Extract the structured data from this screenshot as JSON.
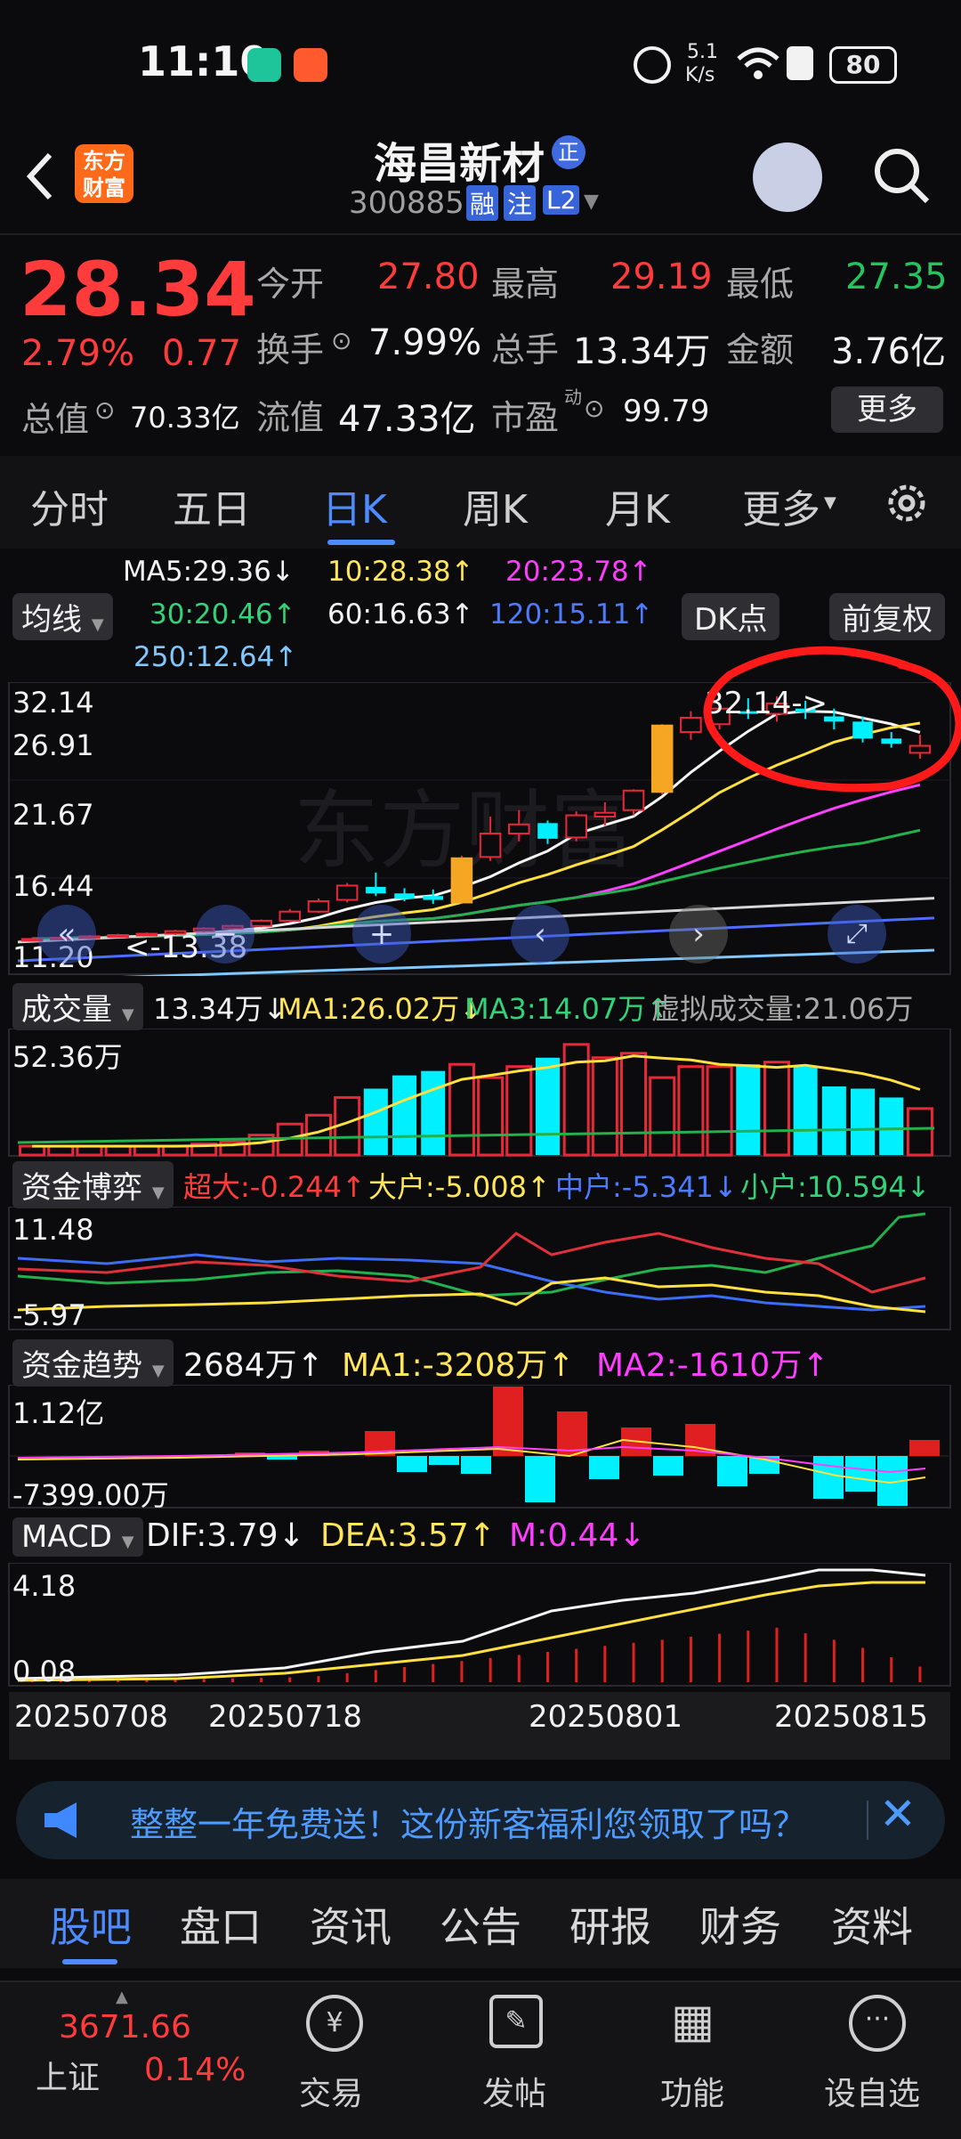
{
  "status_bar": {
    "time": "11:10",
    "net_speed_top": "5.1",
    "net_speed_unit": "K/s",
    "battery": "80"
  },
  "header": {
    "back_label": "<",
    "logo_line1": "东方",
    "logo_line2": "财富",
    "stock_name": "海昌新材",
    "badge_zheng": "正",
    "stock_code": "300885",
    "tag_rong": "融",
    "tag_zhu": "注",
    "tag_l2": "L2"
  },
  "quote": {
    "price": "28.34",
    "change_pct": "2.79%",
    "change_abs": "0.77",
    "open_label": "今开",
    "open": "27.80",
    "high_label": "最高",
    "high": "29.19",
    "low_label": "最低",
    "low": "27.35",
    "turnover_label": "换手",
    "turnover": "7.99%",
    "volume_label": "总手",
    "volume": "13.34万",
    "amount_label": "金额",
    "amount": "3.76亿",
    "total_mv_label": "总值",
    "total_mv": "70.33亿",
    "float_mv_label": "流值",
    "float_mv": "47.33亿",
    "pe_label": "市盈",
    "pe_sup": "动",
    "pe": "99.79",
    "more_label": "更多"
  },
  "period_tabs": [
    "分时",
    "五日",
    "日K",
    "周K",
    "月K",
    "更多"
  ],
  "active_tab": "日K",
  "ma_legend": {
    "ma5": "MA5:29.36↓",
    "ma10": "10:28.38↑",
    "ma20": "20:23.78↑",
    "ma30": "30:20.46↑",
    "ma60": "60:16.63↑",
    "ma120": "120:15.11↑",
    "ma250": "250:12.64↑",
    "junxian": "均线",
    "dk": "DK点",
    "fuquan": "前复权"
  },
  "kline": {
    "y_labels": [
      "32.14",
      "26.91",
      "21.67",
      "16.44",
      "11.20"
    ],
    "max_note": "32.14->",
    "min_note": "<-13.38"
  },
  "volume_panel": {
    "title": "成交量",
    "vol": "13.34万↓",
    "ma1": "MA1:26.02万↓",
    "ma3": "MA3:14.07万↑",
    "virtual": "虚拟成交量:21.06万",
    "y_label": "52.36万"
  },
  "fund_game": {
    "title": "资金博弈",
    "super": "超大:-0.244↑",
    "big": "大户:-5.008↑",
    "mid": "中户:-5.341↓",
    "small": "小户:10.594↓",
    "y_top": "11.48",
    "y_bottom": "-5.97"
  },
  "fund_trend": {
    "title": "资金趋势",
    "val": "2684万↑",
    "ma1": "MA1:-3208万↑",
    "ma2": "MA2:-1610万↑",
    "y_top": "1.12亿",
    "y_bottom": "-7399.00万"
  },
  "macd": {
    "title": "MACD",
    "dif": "DIF:3.79↓",
    "dea": "DEA:3.57↑",
    "m": "M:0.44↓",
    "y_top": "4.18",
    "y_bottom": "0.08"
  },
  "dates": [
    "20250708",
    "20250718",
    "20250801",
    "20250815"
  ],
  "banner": {
    "text": "整整一年免费送！这份新客福利您领取了吗？"
  },
  "bottom_tabs": [
    "股吧",
    "盘口",
    "资讯",
    "公告",
    "研报",
    "财务",
    "资料"
  ],
  "index_quote": {
    "value": "3671.66",
    "name": "上证",
    "pct": "0.14%"
  },
  "nav": [
    "交易",
    "发帖",
    "功能",
    "设自选"
  ],
  "colors": {
    "up": "#ff3b3b",
    "down": "#22c55e",
    "bg": "#0b0b0d",
    "accent": "#4d8bff"
  },
  "chart_data": {
    "type": "candlestick",
    "title": "",
    "ohlc": [
      {
        "o": 13.4,
        "h": 13.6,
        "l": 13.38,
        "c": 13.5
      },
      {
        "o": 13.5,
        "h": 13.7,
        "l": 13.4,
        "c": 13.6
      },
      {
        "o": 13.6,
        "h": 13.8,
        "l": 13.5,
        "c": 13.7
      },
      {
        "o": 13.7,
        "h": 13.9,
        "l": 13.6,
        "c": 13.8
      },
      {
        "o": 13.8,
        "h": 14.0,
        "l": 13.7,
        "c": 13.9
      },
      {
        "o": 13.9,
        "h": 14.2,
        "l": 13.8,
        "c": 14.1
      },
      {
        "o": 14.1,
        "h": 14.4,
        "l": 14.0,
        "c": 14.3
      },
      {
        "o": 14.3,
        "h": 14.6,
        "l": 14.2,
        "c": 14.5
      },
      {
        "o": 14.5,
        "h": 15.0,
        "l": 14.4,
        "c": 14.9
      },
      {
        "o": 14.9,
        "h": 15.8,
        "l": 14.8,
        "c": 15.6
      },
      {
        "o": 15.6,
        "h": 16.6,
        "l": 15.5,
        "c": 16.4
      },
      {
        "o": 16.5,
        "h": 17.8,
        "l": 16.3,
        "c": 17.6
      },
      {
        "o": 17.5,
        "h": 18.6,
        "l": 16.8,
        "c": 17.0
      },
      {
        "o": 17.0,
        "h": 17.4,
        "l": 16.4,
        "c": 16.6
      },
      {
        "o": 16.8,
        "h": 17.3,
        "l": 16.2,
        "c": 16.5
      },
      {
        "o": 16.3,
        "h": 19.9,
        "l": 16.2,
        "c": 19.7
      },
      {
        "o": 19.8,
        "h": 22.9,
        "l": 19.5,
        "c": 21.6
      },
      {
        "o": 21.6,
        "h": 23.4,
        "l": 21.0,
        "c": 22.3
      },
      {
        "o": 22.4,
        "h": 22.6,
        "l": 20.8,
        "c": 21.2
      },
      {
        "o": 21.3,
        "h": 23.3,
        "l": 21.0,
        "c": 23.0
      },
      {
        "o": 22.9,
        "h": 24.0,
        "l": 22.2,
        "c": 23.2
      },
      {
        "o": 23.4,
        "h": 25.0,
        "l": 23.0,
        "c": 24.9
      },
      {
        "o": 24.8,
        "h": 30.0,
        "l": 24.6,
        "c": 29.9
      },
      {
        "o": 29.4,
        "h": 31.0,
        "l": 28.8,
        "c": 30.5
      },
      {
        "o": 30.0,
        "h": 31.5,
        "l": 29.6,
        "c": 31.2
      },
      {
        "o": 31.0,
        "h": 32.0,
        "l": 30.4,
        "c": 30.8
      },
      {
        "o": 30.8,
        "h": 32.14,
        "l": 30.2,
        "c": 31.6
      },
      {
        "o": 31.2,
        "h": 31.8,
        "l": 30.4,
        "c": 30.9
      },
      {
        "o": 30.6,
        "h": 31.2,
        "l": 29.6,
        "c": 30.2
      },
      {
        "o": 30.2,
        "h": 30.6,
        "l": 28.6,
        "c": 28.9
      },
      {
        "o": 28.9,
        "h": 29.4,
        "l": 28.2,
        "c": 28.5
      },
      {
        "o": 27.8,
        "h": 29.19,
        "l": 27.35,
        "c": 28.34
      }
    ],
    "volume_wan": [
      4,
      4,
      4,
      4,
      4,
      4,
      5,
      6,
      9,
      14,
      18,
      26,
      30,
      36,
      38,
      41,
      35,
      40,
      44,
      50,
      44,
      46,
      35,
      40,
      40,
      41,
      42,
      40,
      31,
      30,
      26,
      21
    ]
  }
}
